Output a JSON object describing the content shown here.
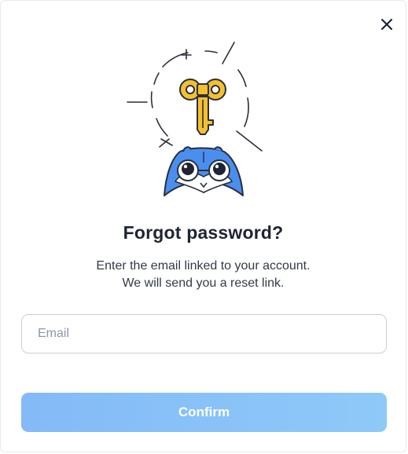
{
  "dialog": {
    "title": "Forgot password?",
    "subtitle_line1": "Enter the email linked to your account.",
    "subtitle_line2": "We will send you a reset link.",
    "email_placeholder": "Email",
    "email_value": "",
    "confirm_label": "Confirm"
  },
  "icons": {
    "close": "close-icon",
    "illustration": "mascot-with-key-illustration"
  },
  "colors": {
    "title": "#1e2433",
    "text": "#333a47",
    "placeholder": "#8d96a7",
    "input_border": "#c9ced8",
    "button_gradient_start": "#84baf7",
    "button_gradient_end": "#8ec9f8",
    "key_yellow": "#f5c02f",
    "mascot_blue": "#4a8ff0"
  }
}
